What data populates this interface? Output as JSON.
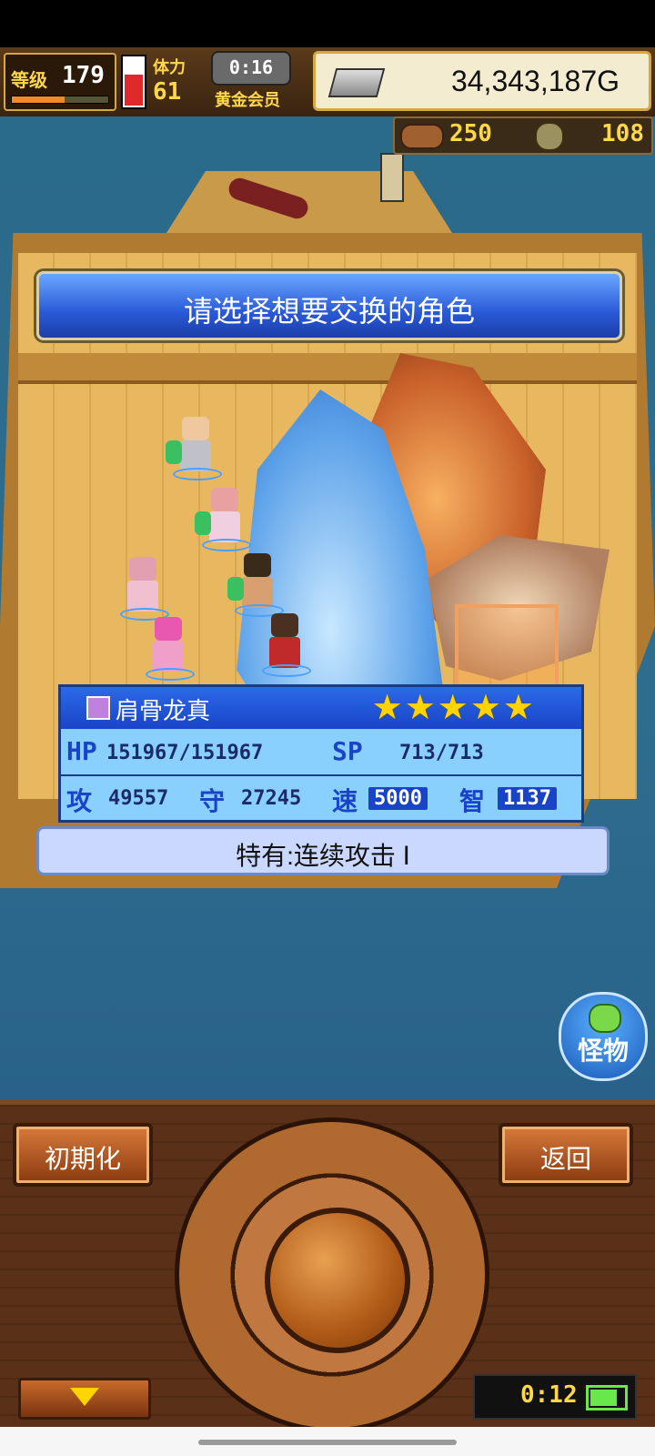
{
  "hud": {
    "level_label": "等级",
    "level_value": "179",
    "exp_percent": 55,
    "stamina_label": "体力",
    "stamina_value": "61",
    "stamina_gauge_percent": 60,
    "timer": "0:16",
    "member_label": "黄金会员",
    "gold": "34,343,187G"
  },
  "resources": {
    "meat": "250",
    "herb": "108"
  },
  "banner": {
    "text": "请选择想要交换的角色"
  },
  "monster_info": {
    "name": "肩骨龙真",
    "stars": "★★★★★",
    "hp_label": "HP",
    "hp_value": "151967/151967",
    "sp_label": "SP",
    "sp_value": "713/713",
    "atk_label": "攻",
    "atk_value": "49557",
    "def_label": "守",
    "def_value": "27245",
    "spd_label": "速",
    "spd_value": "5000",
    "int_label": "智",
    "int_value": "1137"
  },
  "trait": {
    "text": "特有:连续攻击 Ⅰ"
  },
  "monster_button": {
    "label": "怪物"
  },
  "controls": {
    "reset_label": "初期化",
    "back_label": "返回",
    "battery_timer": "0:12",
    "battery_percent": 80
  },
  "colors": {
    "banner_blue": "#2a5ad8",
    "panel_blue": "#8ad0ff",
    "gold_text": "#ffd84a",
    "star_yellow": "#ffd400"
  }
}
